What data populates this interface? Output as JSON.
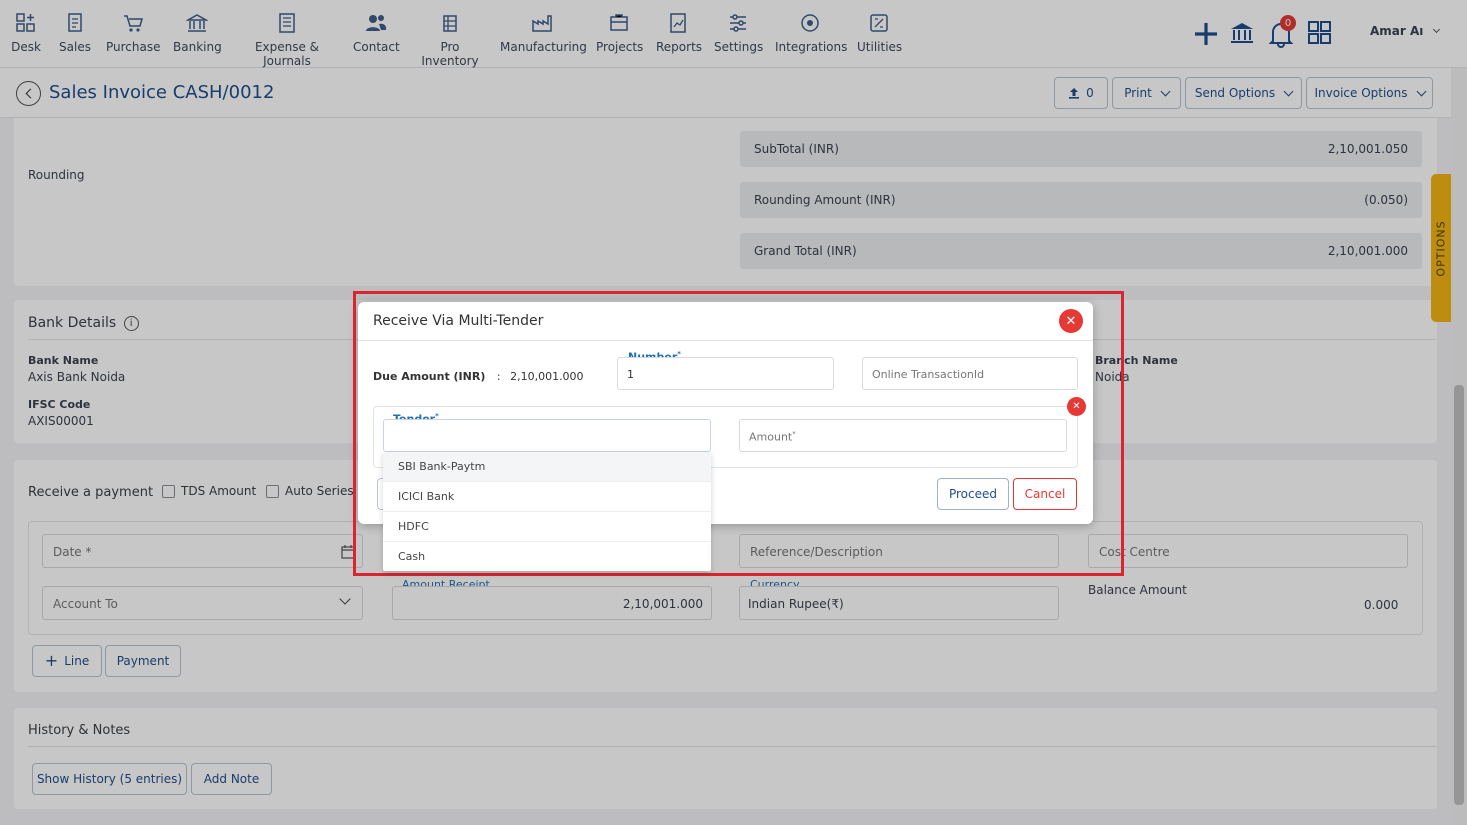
{
  "nav": {
    "items": [
      {
        "label": "Desk",
        "icon": "desk-icon"
      },
      {
        "label": "Sales",
        "icon": "sales-icon"
      },
      {
        "label": "Purchase",
        "icon": "cart-icon"
      },
      {
        "label": "Banking",
        "icon": "bank-icon"
      },
      {
        "label": "Expense & Journals",
        "icon": "journal-icon"
      },
      {
        "label": "Contact",
        "icon": "contact-icon"
      },
      {
        "label": "Pro Inventory",
        "icon": "inventory-icon"
      },
      {
        "label": "Manufacturing",
        "icon": "manufacturing-icon"
      },
      {
        "label": "Projects",
        "icon": "projects-icon"
      },
      {
        "label": "Reports",
        "icon": "reports-icon"
      },
      {
        "label": "Settings",
        "icon": "settings-icon"
      },
      {
        "label": "Integrations",
        "icon": "integrations-icon"
      },
      {
        "label": "Utilities",
        "icon": "utilities-icon"
      }
    ],
    "notification_count": "0",
    "user_name": "Amar Aı"
  },
  "header": {
    "title": "Sales Invoice CASH/0012",
    "attach_count": "0",
    "print_label": "Print",
    "send_options_label": "Send Options",
    "invoice_options_label": "Invoice Options"
  },
  "totals": {
    "rounding_label": "Rounding",
    "subtotal_label": "SubTotal (INR)",
    "subtotal_value": "2,10,001.050",
    "rounding_amount_label": "Rounding Amount (INR)",
    "rounding_amount_value": "(0.050)",
    "grand_total_label": "Grand Total (INR)",
    "grand_total_value": "2,10,001.000"
  },
  "options_tab": "OPTIONS",
  "bank": {
    "title": "Bank Details",
    "bank_name_label": "Bank Name",
    "bank_name_value": "Axis Bank Noida",
    "ifsc_label": "IFSC Code",
    "ifsc_value": "AXIS00001",
    "branch_label": "Branch Name",
    "branch_value": "Noida"
  },
  "payment": {
    "title": "Receive a payment",
    "tds_label": "TDS Amount",
    "auto_series_label": "Auto Series",
    "date_placeholder": "Date *",
    "reference_placeholder": "Reference/Description",
    "cost_centre_placeholder": "Cost Centre",
    "account_to_label": "Account To",
    "amount_receipt_label": "Amount Receipt",
    "amount_receipt_value": "2,10,001.000",
    "currency_label": "Currency",
    "currency_value": "Indian Rupee(₹)",
    "balance_label": "Balance Amount",
    "balance_value": "0.000",
    "line_button": "Line",
    "payment_button": "Payment"
  },
  "history": {
    "title": "History & Notes",
    "show_history_button": "Show History (5 entries)",
    "add_note_button": "Add Note"
  },
  "modal": {
    "title": "Receive Via Multi-Tender",
    "due_amount_label": "Due Amount (INR)",
    "due_amount_sep": ":",
    "due_amount_value": "2,10,001.000",
    "number_label": "Number",
    "number_value": "1",
    "transaction_placeholder": "Online TransactionId",
    "tender_label": "Tender",
    "amount_placeholder": "Amount",
    "proceed_button": "Proceed",
    "cancel_button": "Cancel",
    "tender_options": [
      "SBI Bank-Paytm",
      "ICICI Bank",
      "HDFC",
      "Cash"
    ]
  },
  "colors": {
    "accent": "#1f4e8c",
    "danger": "#e53935",
    "highlight_box": "#d9252f",
    "options_tab": "#f3b514"
  }
}
